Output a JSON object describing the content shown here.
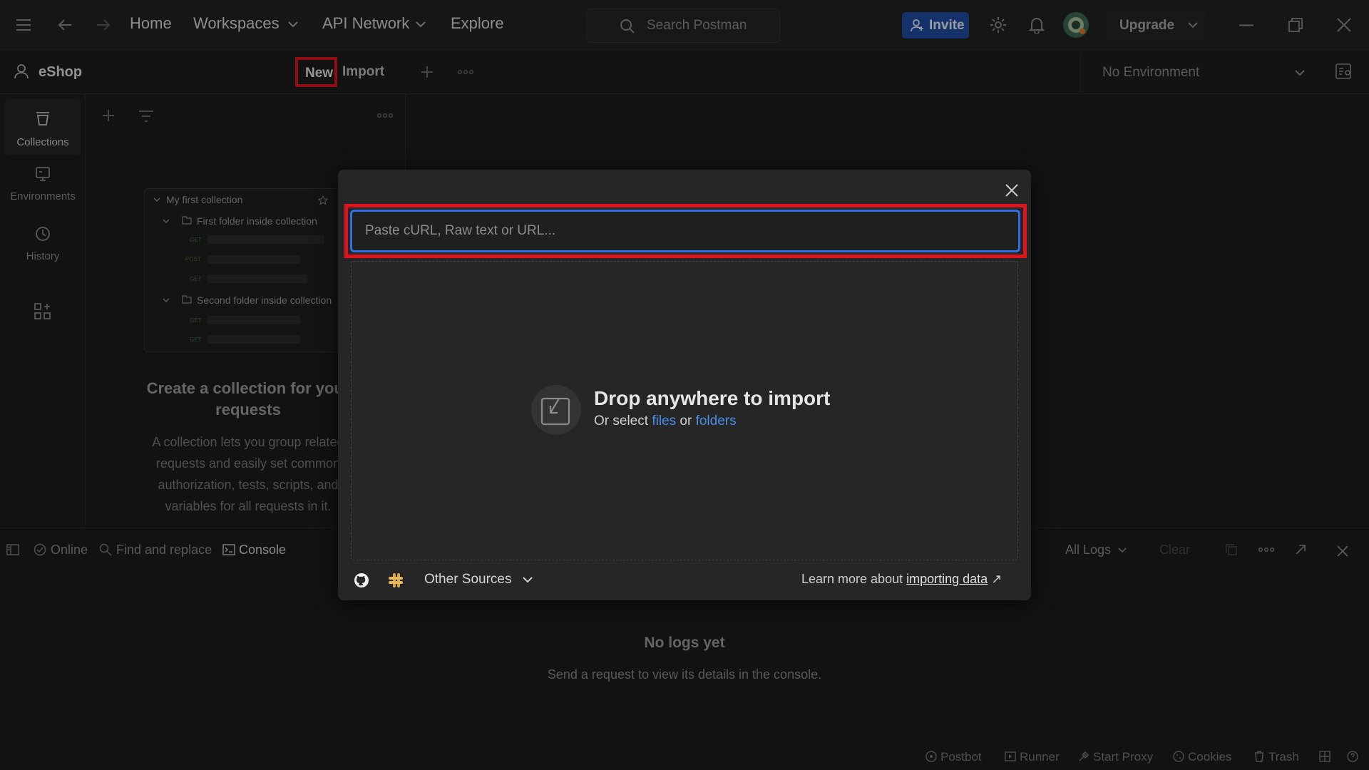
{
  "topbar": {
    "nav": {
      "home": "Home",
      "workspaces": "Workspaces",
      "api_network": "API Network",
      "explore": "Explore"
    },
    "search_placeholder": "Search Postman",
    "invite_label": "Invite",
    "upgrade_label": "Upgrade"
  },
  "workspace": {
    "name": "eShop",
    "new_label": "New",
    "import_label": "Import",
    "environment": "No Environment"
  },
  "rail": {
    "items": [
      {
        "label": "Collections"
      },
      {
        "label": "Environments"
      },
      {
        "label": "History"
      }
    ]
  },
  "sidebar": {
    "preview": {
      "collection": "My first collection",
      "folder1": "First folder inside collection",
      "folder2": "Second folder inside collection",
      "methods": [
        "GET",
        "POST",
        "GET",
        "GET",
        "GET"
      ]
    },
    "create_title": "Create a collection for your requests",
    "create_desc": "A collection lets you group related requests and easily set common authorization, tests, scripts, and variables for all requests in it."
  },
  "console": {
    "online": "Online",
    "find_replace": "Find and replace",
    "console_tab": "Console",
    "all_logs": "All Logs",
    "clear": "Clear",
    "no_logs_title": "No logs yet",
    "no_logs_sub": "Send a request to view its details in the console."
  },
  "statusbar": {
    "postbot": "Postbot",
    "runner": "Runner",
    "start_proxy": "Start Proxy",
    "cookies": "Cookies",
    "trash": "Trash"
  },
  "import_modal": {
    "input_placeholder": "Paste cURL, Raw text or URL...",
    "drop_title": "Drop anywhere to import",
    "drop_prefix": "Or select",
    "files_link": "files",
    "or_word": "or",
    "folders_link": "folders",
    "other_sources": "Other Sources",
    "learn_prefix": "Learn more about",
    "learn_link": "importing data",
    "learn_arrow": "↗"
  },
  "colors": {
    "accent_blue": "#2f6fe6",
    "invite_bg": "#1f4ea1",
    "highlight_red": "#e0141e",
    "console_tab_underline": "#e4572e"
  }
}
